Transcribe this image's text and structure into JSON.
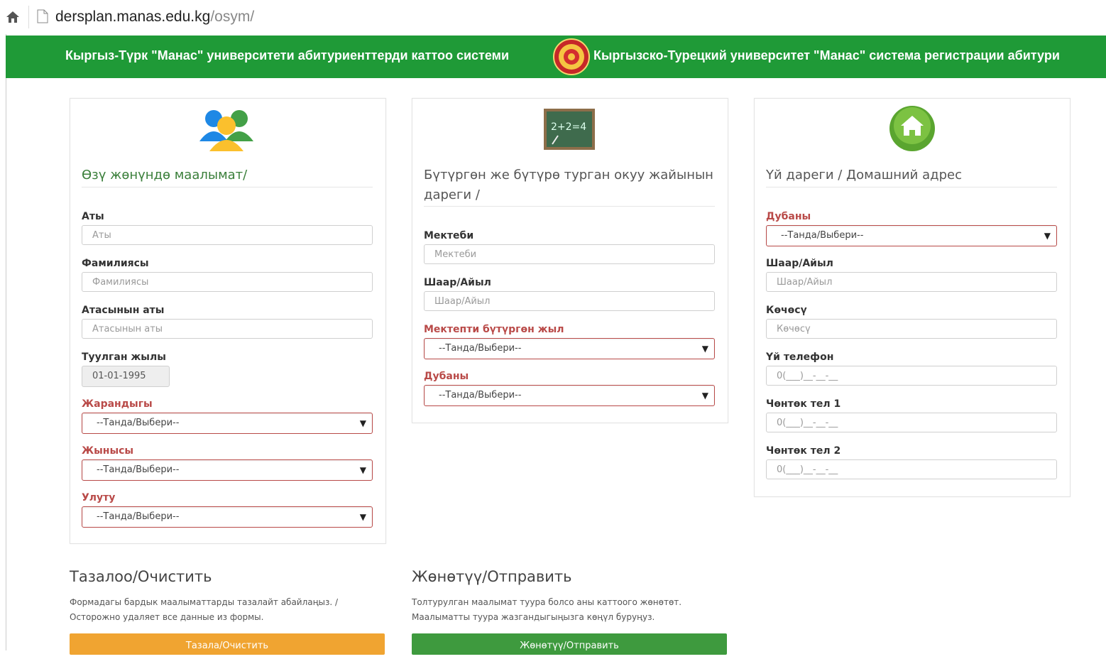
{
  "browser": {
    "url_host": "dersplan.manas.edu.kg",
    "url_path": "/osym/"
  },
  "banner": {
    "left_text": "Кыргыз-Түрк \"Манас\" университети абитуриенттерди каттоо системи",
    "right_text": "Кыргызско-Турецкий университет \"Манас\" система регистрации абитури"
  },
  "personal": {
    "title": "Өзү жөнүндө маалымат/",
    "fields": [
      {
        "label": "Аты",
        "placeholder": "Аты"
      },
      {
        "label": "Фамилиясы",
        "placeholder": "Фамилиясы"
      },
      {
        "label": "Атасынын аты",
        "placeholder": "Атасынын аты"
      }
    ],
    "birth_label": "Туулган жылы",
    "birth_value": "01-01-1995",
    "selects": [
      {
        "label": "Жарандыгы",
        "value": "--Танда/Выбери--"
      },
      {
        "label": "Жынысы",
        "value": "--Танда/Выбери--"
      },
      {
        "label": "Улуту",
        "value": "--Танда/Выбери--"
      }
    ]
  },
  "school": {
    "title_line1": "Бүтүргөн же бүтүрө турган окуу жайынын",
    "title_line2": "дареги /",
    "fields": [
      {
        "label": "Мектеби",
        "placeholder": "Мектеби"
      },
      {
        "label": "Шаар/Айыл",
        "placeholder": "Шаар/Айыл"
      }
    ],
    "selects": [
      {
        "label": "Мектепти бүтүргөн жыл",
        "value": "--Танда/Выбери--"
      },
      {
        "label": "Дубаны",
        "value": "--Танда/Выбери--"
      }
    ]
  },
  "address": {
    "title": "Үй дареги / Домашний адрес",
    "select": {
      "label": "Дубаны",
      "value": "--Танда/Выбери--"
    },
    "fields": [
      {
        "label": "Шаар/Айыл",
        "placeholder": "Шаар/Айыл"
      },
      {
        "label": "Көчөсү",
        "placeholder": "Көчөсү"
      },
      {
        "label": "Үй телефон",
        "placeholder": "0(___)__-__-__"
      },
      {
        "label": "Чөнтөк тел 1",
        "placeholder": "0(___)__-__-__"
      },
      {
        "label": "Чөнтөк тел 2",
        "placeholder": "0(___)__-__-__"
      }
    ]
  },
  "clear_section": {
    "title": "Тазалоо/Очистить",
    "desc_line1": "Формадагы бардык маалыматтарды тазалайт абайлаңыз. /",
    "desc_line2": "Осторожно удаляет все данные из формы.",
    "button": "Тазала/Очистить"
  },
  "send_section": {
    "title": "Жөнөтүү/Отправить",
    "desc_line1": "Толтурулган маалымат туура болсо аны каттоого жөнөтөт.",
    "desc_line2": "Маалыматты туура жазгандыгыңызга көңүл буруңуз.",
    "button": "Жөнөтүү/Отправить"
  },
  "icons": [
    "home-icon",
    "page-icon",
    "logo-emblem",
    "people-icon",
    "chalkboard-icon",
    "house-icon",
    "dropdown-arrow-icon"
  ]
}
